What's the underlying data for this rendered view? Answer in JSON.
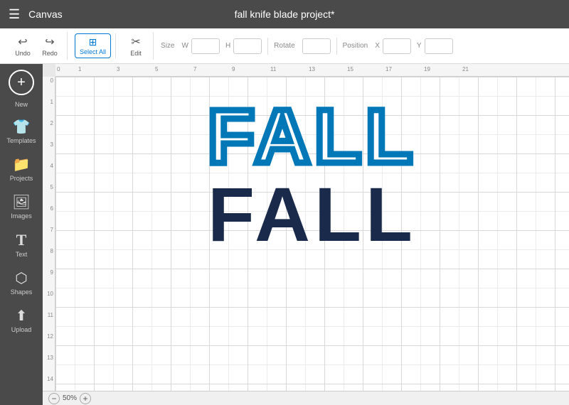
{
  "topbar": {
    "menu_icon": "☰",
    "app_title": "Canvas",
    "project_title": "fall knife blade project*"
  },
  "toolbar": {
    "undo_label": "Undo",
    "redo_label": "Redo",
    "select_all_label": "Select All",
    "edit_label": "Edit",
    "size_label": "Size",
    "w_label": "W",
    "h_label": "H",
    "rotate_label": "Rotate",
    "position_label": "Position",
    "x_label": "X",
    "y_label": "Y"
  },
  "sidebar": {
    "new_label": "New",
    "items": [
      {
        "id": "templates",
        "icon": "👕",
        "label": "Templates"
      },
      {
        "id": "projects",
        "icon": "📁",
        "label": "Projects"
      },
      {
        "id": "images",
        "icon": "🖼",
        "label": "Images"
      },
      {
        "id": "text",
        "icon": "T",
        "label": "Text"
      },
      {
        "id": "shapes",
        "icon": "⬡",
        "label": "Shapes"
      },
      {
        "id": "upload",
        "icon": "⬆",
        "label": "Upload"
      }
    ]
  },
  "canvas": {
    "zoom_level": "50%",
    "fall_top_text": "FALL",
    "fall_bottom_text": "FALL",
    "ruler_h_marks": [
      "0",
      "1",
      "3",
      "5",
      "7",
      "9",
      "11",
      "13",
      "15",
      "17",
      "19",
      "21"
    ],
    "ruler_v_marks": [
      "0",
      "1",
      "2",
      "3",
      "4",
      "5",
      "6",
      "7",
      "8",
      "9",
      "10",
      "11",
      "12",
      "13",
      "14"
    ]
  },
  "colors": {
    "accent_blue": "#0077b6",
    "dark_navy": "#1a2a4a",
    "toolbar_bg": "#ffffff",
    "sidebar_bg": "#4a4a4a",
    "topbar_bg": "#4a4a4a"
  }
}
